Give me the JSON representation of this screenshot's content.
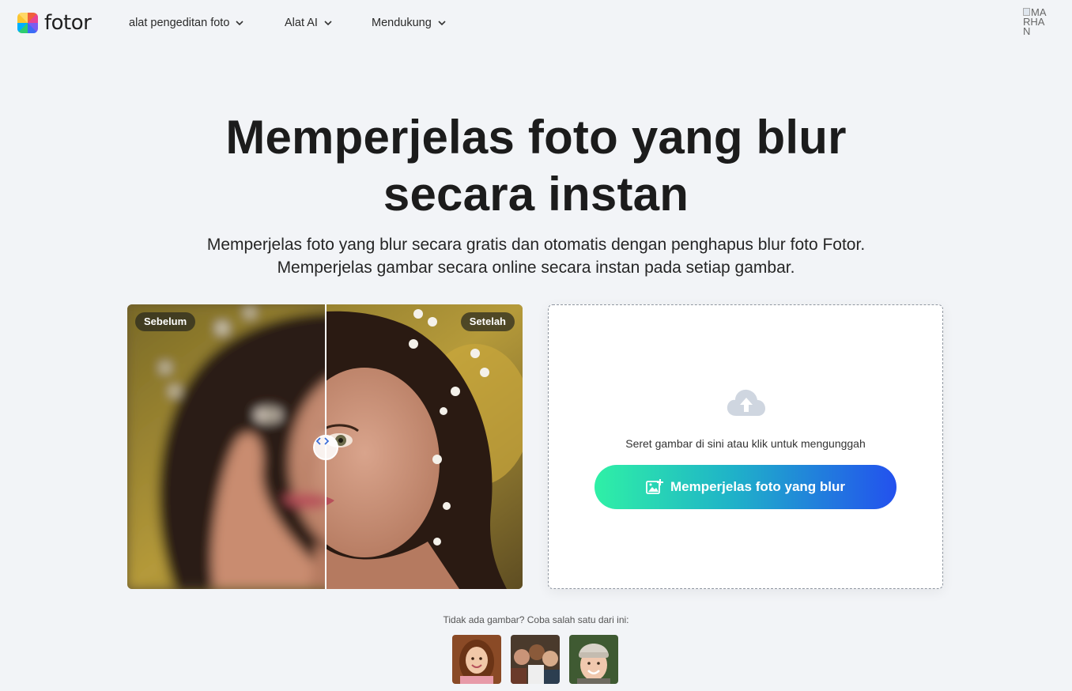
{
  "brand": {
    "name": "fotor"
  },
  "nav": {
    "items": [
      {
        "label": "alat pengeditan foto"
      },
      {
        "label": "Alat AI"
      },
      {
        "label": "Mendukung"
      }
    ]
  },
  "user": {
    "avatar_alt": "MARHAN"
  },
  "hero": {
    "title_line1": "Memperjelas foto yang blur",
    "title_line2": "secara instan",
    "subtitle_line1": "Memperjelas foto yang blur secara gratis dan otomatis dengan penghapus blur foto Fotor.",
    "subtitle_line2": "Memperjelas gambar secara online secara instan pada setiap gambar."
  },
  "compare": {
    "before_label": "Sebelum",
    "after_label": "Setelah",
    "slider_position": 0.5
  },
  "upload": {
    "hint": "Seret gambar di sini atau klik untuk mengunggah",
    "button_label": "Memperjelas foto yang blur"
  },
  "samples": {
    "label": "Tidak ada gambar? Coba salah satu dari ini:",
    "items": [
      {
        "icon": "girl-portrait"
      },
      {
        "icon": "group-portrait"
      },
      {
        "icon": "woman-beanie-portrait"
      }
    ]
  },
  "colors": {
    "background": "#f2f4f7",
    "cta_gradient_start": "#2ff0a6",
    "cta_gradient_end": "#2351ee",
    "cloud_icon": "#cfd6e0"
  }
}
